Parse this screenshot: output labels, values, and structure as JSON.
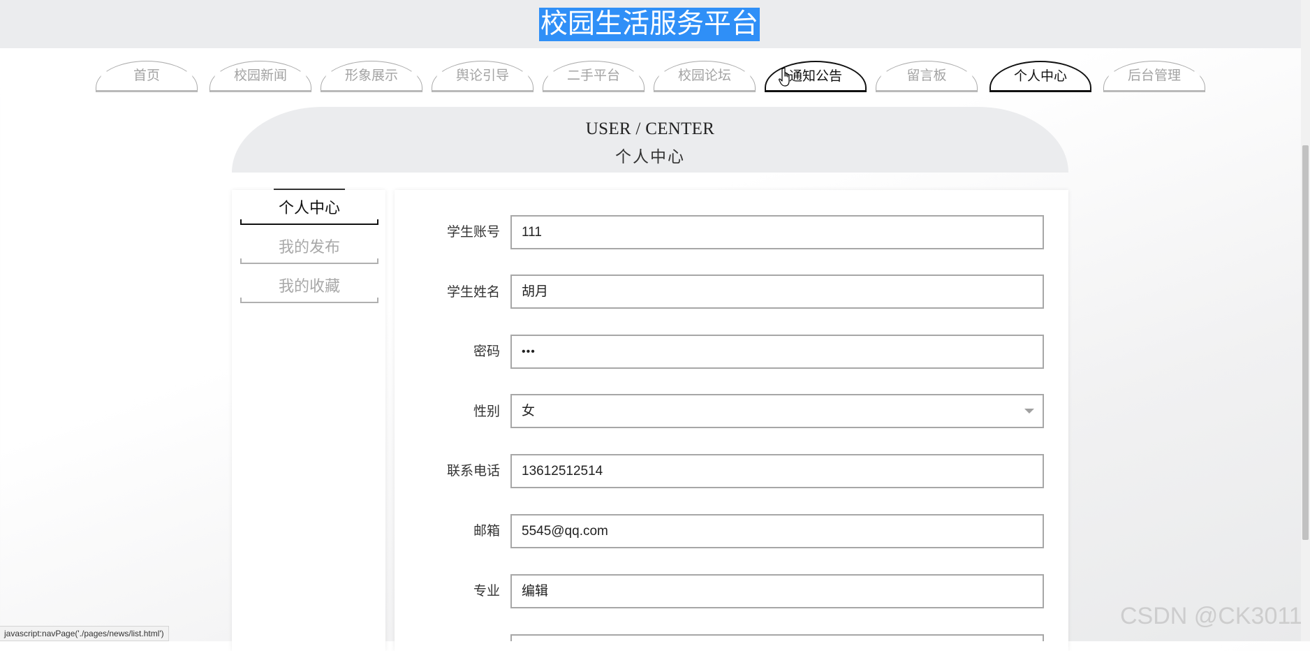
{
  "header": {
    "title": "校园生活服务平台"
  },
  "nav": {
    "tabs": [
      {
        "label": "首页",
        "active": false
      },
      {
        "label": "校园新闻",
        "active": false
      },
      {
        "label": "形象展示",
        "active": false
      },
      {
        "label": "舆论引导",
        "active": false
      },
      {
        "label": "二手平台",
        "active": false
      },
      {
        "label": "校园论坛",
        "active": false
      },
      {
        "label": "通知公告",
        "active": true
      },
      {
        "label": "留言板",
        "active": false
      },
      {
        "label": "个人中心",
        "active": true
      },
      {
        "label": "后台管理",
        "active": false
      }
    ]
  },
  "banner": {
    "title_en": "USER / CENTER",
    "title_cn": "个人中心"
  },
  "side_menu": {
    "items": [
      {
        "label": "个人中心",
        "active": true
      },
      {
        "label": "我的发布",
        "active": false
      },
      {
        "label": "我的收藏",
        "active": false
      }
    ]
  },
  "form": {
    "fields": [
      {
        "label": "学生账号",
        "value": "111"
      },
      {
        "label": "学生姓名",
        "value": "胡月"
      },
      {
        "label": "密码",
        "value": "•••"
      },
      {
        "label": "性别",
        "value": "女"
      },
      {
        "label": "联系电话",
        "value": "13612512514"
      },
      {
        "label": "邮箱",
        "value": "5545@qq.com"
      },
      {
        "label": "专业",
        "value": "编辑"
      }
    ]
  },
  "status_bar": {
    "text": "javascript:navPage('./pages/news/list.html')"
  },
  "watermark": {
    "text": "CSDN @CK3011"
  },
  "colors": {
    "title_highlight": "#2f8ff7",
    "header_bg": "#ebecee",
    "active_border": "#111111",
    "inactive_text": "#a3a3a3"
  }
}
